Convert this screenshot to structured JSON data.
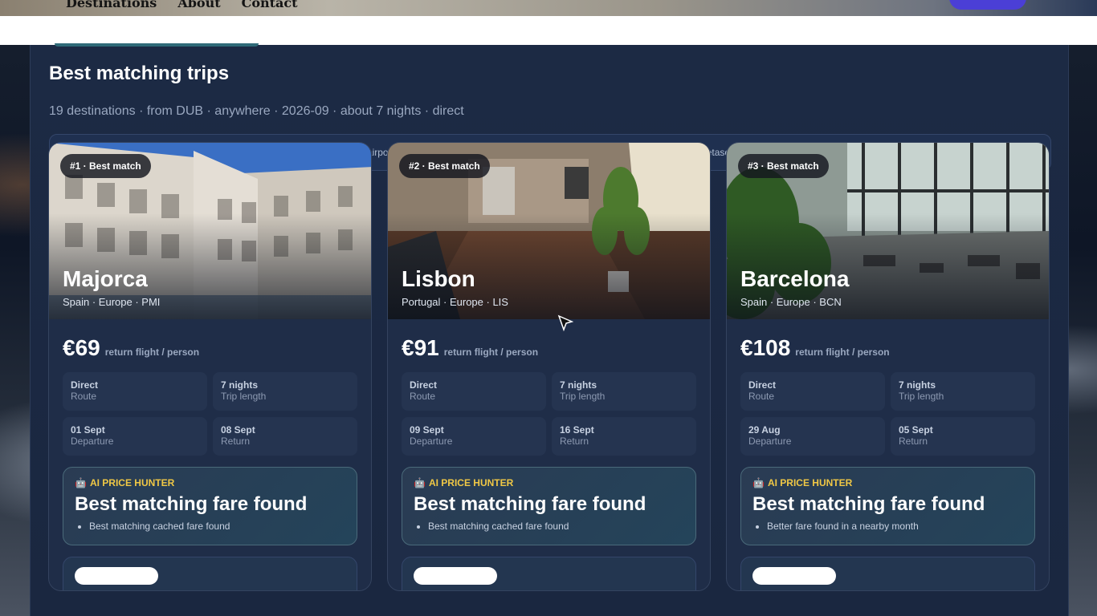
{
  "nav": {
    "links": [
      "Destinations",
      "About",
      "Contact"
    ]
  },
  "results": {
    "title": "Best matching trips",
    "summary": "19 destinations · from DUB · anywhere · 2026-09 · about 7 nights · direct",
    "notice": "Global Deep Search checks broad cached fares and important regional airports individually across nearby date windows. It still does not have full live metasearch inventory, so final market-lowest price is not guaranteed."
  },
  "cards": [
    {
      "rank": "#1 · Best match",
      "city": "Majorca",
      "meta": "Spain · Europe · PMI",
      "price": "€69",
      "price_note": "return flight / person",
      "route_value": "Direct",
      "route_label": "Route",
      "length_value": "7 nights",
      "length_label": "Trip length",
      "departure_value": "01 Sept",
      "departure_label": "Departure",
      "return_value": "08 Sept",
      "return_label": "Return",
      "hunter_tag": "AI PRICE HUNTER",
      "hunter_head": "Best matching fare found",
      "hunter_note": "Best matching cached fare found"
    },
    {
      "rank": "#2 · Best match",
      "city": "Lisbon",
      "meta": "Portugal · Europe · LIS",
      "price": "€91",
      "price_note": "return flight / person",
      "route_value": "Direct",
      "route_label": "Route",
      "length_value": "7 nights",
      "length_label": "Trip length",
      "departure_value": "09 Sept",
      "departure_label": "Departure",
      "return_value": "16 Sept",
      "return_label": "Return",
      "hunter_tag": "AI PRICE HUNTER",
      "hunter_head": "Best matching fare found",
      "hunter_note": "Best matching cached fare found"
    },
    {
      "rank": "#3 · Best match",
      "city": "Barcelona",
      "meta": "Spain · Europe · BCN",
      "price": "€108",
      "price_note": "return flight / person",
      "route_value": "Direct",
      "route_label": "Route",
      "length_value": "7 nights",
      "length_label": "Trip length",
      "departure_value": "29 Aug",
      "departure_label": "Departure",
      "return_value": "05 Sept",
      "return_label": "Return",
      "hunter_tag": "AI PRICE HUNTER",
      "hunter_head": "Best matching fare found",
      "hunter_note": "Better fare found in a nearby month"
    }
  ],
  "colors": {
    "accent_purple": "#4b3fd6",
    "hunter_tag": "#f0c845",
    "panel_bg": "#1c2a44"
  }
}
